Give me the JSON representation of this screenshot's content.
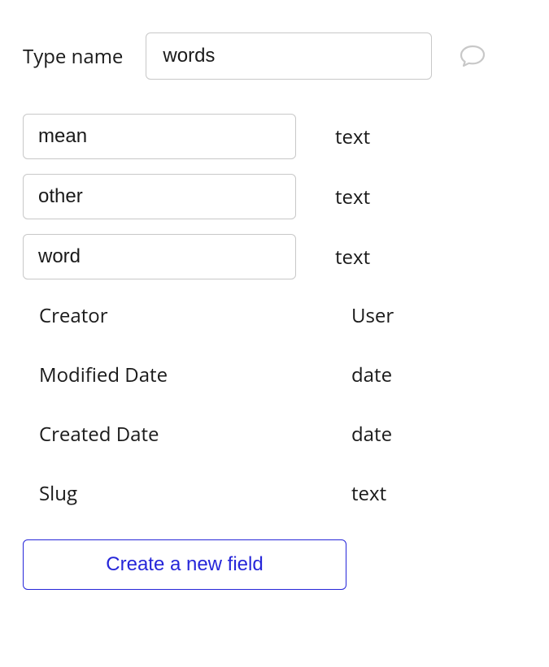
{
  "header": {
    "label": "Type name",
    "value": "words"
  },
  "editable_fields": [
    {
      "name": "mean",
      "type": "text"
    },
    {
      "name": "other",
      "type": "text"
    },
    {
      "name": "word",
      "type": "text"
    }
  ],
  "readonly_fields": [
    {
      "name": "Creator",
      "type": "User"
    },
    {
      "name": "Modified Date",
      "type": "date"
    },
    {
      "name": "Created Date",
      "type": "date"
    },
    {
      "name": "Slug",
      "type": "text"
    }
  ],
  "create_button_label": "Create a new field"
}
